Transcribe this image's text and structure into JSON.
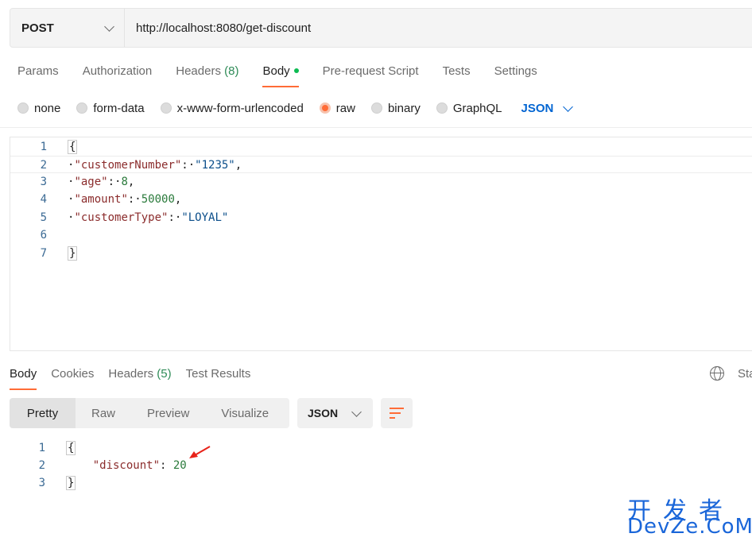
{
  "request": {
    "method": "POST",
    "url": "http://localhost:8080/get-discount"
  },
  "request_tabs": {
    "params": "Params",
    "authorization": "Authorization",
    "headers": "Headers",
    "headers_count": "(8)",
    "body": "Body",
    "prerequest": "Pre-request Script",
    "tests": "Tests",
    "settings": "Settings"
  },
  "body_types": {
    "none": "none",
    "form_data": "form-data",
    "urlencoded": "x-www-form-urlencoded",
    "raw": "raw",
    "binary": "binary",
    "graphql": "GraphQL",
    "format": "JSON"
  },
  "request_body": {
    "line_numbers": [
      "1",
      "2",
      "3",
      "4",
      "5",
      "6",
      "7"
    ],
    "open_brace": "{",
    "close_brace": "}",
    "key1": "\"customerNumber\"",
    "val1": "\"1235\"",
    "key2": "\"age\"",
    "val2": "8",
    "key3": "\"amount\"",
    "val3": "50000",
    "key4": "\"customerType\"",
    "val4": "\"LOYAL\""
  },
  "response_tabs": {
    "body": "Body",
    "cookies": "Cookies",
    "headers": "Headers",
    "headers_count": "(5)",
    "test_results": "Test Results",
    "status_partial": "Sta"
  },
  "response_toolbar": {
    "pretty": "Pretty",
    "raw": "Raw",
    "preview": "Preview",
    "visualize": "Visualize",
    "format": "JSON"
  },
  "response_body": {
    "line_numbers": [
      "1",
      "2",
      "3"
    ],
    "open_brace": "{",
    "close_brace": "}",
    "key": "\"discount\"",
    "value": "20"
  },
  "watermark": {
    "line1": "开发者",
    "line2": "DevZe.CoM"
  },
  "colors": {
    "accent": "#ff6c37",
    "link": "#0265d2",
    "count_green": "#2e8b57",
    "annotation_arrow": "#e8231a"
  }
}
